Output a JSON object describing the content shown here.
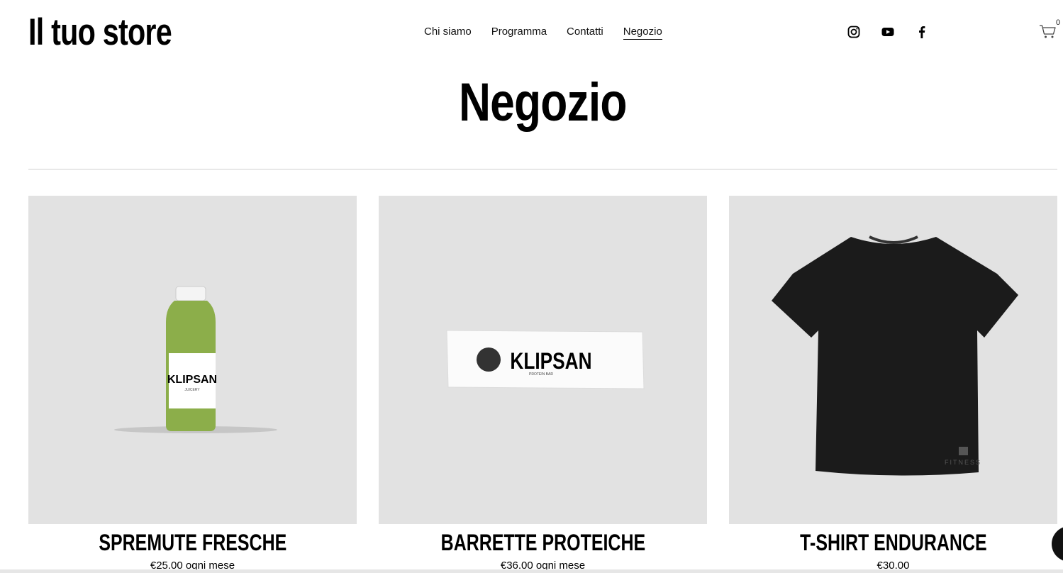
{
  "site": {
    "logo": "Il tuo store"
  },
  "nav": {
    "items": [
      "Chi siamo",
      "Programma",
      "Contatti",
      "Negozio"
    ],
    "active_index": 3
  },
  "social": [
    "instagram-icon",
    "youtube-icon",
    "facebook-icon"
  ],
  "cart": {
    "count": "0",
    "icon": "cart-icon"
  },
  "page": {
    "title": "Negozio"
  },
  "products": [
    {
      "name": "SPREMUTE FRESCHE",
      "price": "€25.00 ogni mese",
      "brand": "KLIPSAN",
      "sub": "JUICERY"
    },
    {
      "name": "BARRETTE PROTEICHE",
      "price": "€36.00 ogni mese",
      "brand": "KLIPSAN",
      "sub": "PROTEIN BAR"
    },
    {
      "name": "T-SHIRT ENDURANCE",
      "price": "€30.00",
      "brand": "FITNESS"
    }
  ],
  "colors": {
    "image_bg": "#e2e2e2",
    "juice": "#8cae4a",
    "shirt": "#1b1b1b"
  }
}
